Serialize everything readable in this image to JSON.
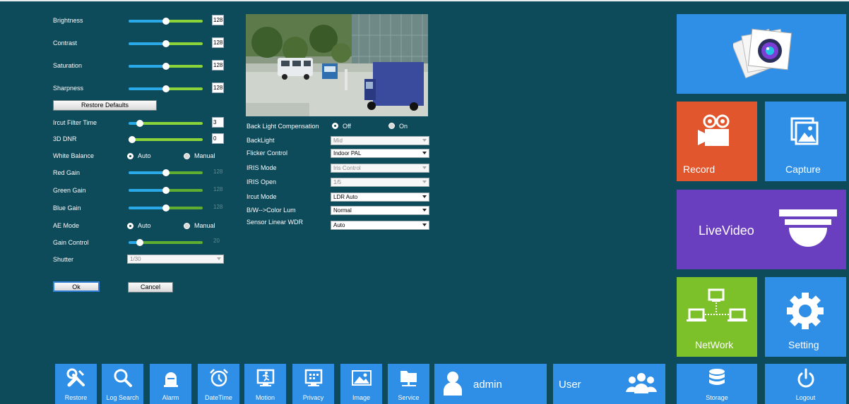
{
  "sliders": {
    "brightness": {
      "label": "Brightness",
      "value": "128",
      "level": 0.5
    },
    "contrast": {
      "label": "Contrast",
      "value": "128",
      "level": 0.5
    },
    "saturation": {
      "label": "Saturation",
      "value": "128",
      "level": 0.5
    },
    "sharpness": {
      "label": "Sharpness",
      "value": "128",
      "level": 0.5
    },
    "ircut_filter_time": {
      "label": "Ircut Filter Time",
      "value": "3",
      "level": 0.15
    },
    "dnr_3d": {
      "label": "3D DNR",
      "value": "0",
      "level": 0.0
    },
    "red_gain": {
      "label": "Red Gain",
      "value": "128",
      "level": 0.5
    },
    "green_gain": {
      "label": "Green Gain",
      "value": "128",
      "level": 0.5
    },
    "blue_gain": {
      "label": "Blue Gain",
      "value": "128",
      "level": 0.5
    },
    "gain_control": {
      "label": "Gain Control",
      "value": "20",
      "level": 0.15
    }
  },
  "restore_defaults_label": "Restore Defaults",
  "white_balance": {
    "label": "White Balance",
    "options": [
      "Auto",
      "Manual"
    ],
    "selected": "Auto"
  },
  "ae_mode": {
    "label": "AE Mode",
    "options": [
      "Auto",
      "Manual"
    ],
    "selected": "Auto"
  },
  "shutter": {
    "label": "Shutter",
    "value": "1/30"
  },
  "ok_label": "Ok",
  "cancel_label": "Cancel",
  "right_settings": {
    "back_light_compensation": {
      "label": "Back Light Compensation",
      "options": [
        "Off",
        "On"
      ],
      "selected": "Off"
    },
    "backlight": {
      "label": "BackLight",
      "value": "Mid",
      "disabled": true
    },
    "flicker_control": {
      "label": "Flicker Control",
      "value": "Indoor PAL",
      "disabled": false
    },
    "iris_mode": {
      "label": "IRIS Mode",
      "value": "Iris Control",
      "disabled": true
    },
    "iris_open": {
      "label": "IRIS Open",
      "value": "1/5",
      "disabled": true
    },
    "ircut_mode": {
      "label": "Ircut Mode",
      "value": "LDR Auto",
      "disabled": false
    },
    "bw_color_lum": {
      "label": "B/W-->Color Lum",
      "value": "Normal",
      "disabled": false
    },
    "sensor_linear_wdr": {
      "label": "Sensor Linear WDR",
      "value": "Auto",
      "disabled": false
    }
  },
  "tiles": {
    "record": "Record",
    "capture": "Capture",
    "livevideo": "LiveVideo",
    "network": "NetWork",
    "setting": "Setting"
  },
  "bottom_bar": {
    "restore": "Restore",
    "log_search": "Log Search",
    "alarm": "Alarm",
    "datetime": "DateTime",
    "motion": "Motion",
    "privacy": "Privacy",
    "image": "Image",
    "service": "Service",
    "username": "admin",
    "user": "User",
    "storage": "Storage",
    "logout": "Logout"
  },
  "colors": {
    "background": "#0d4a5a",
    "tile_blue": "#2f8fe6",
    "tile_orange": "#e2562d",
    "tile_purple": "#6a3fbf",
    "tile_green": "#7cc02a",
    "slider_blue": "#29a9e8",
    "slider_green": "#8ad43a"
  }
}
